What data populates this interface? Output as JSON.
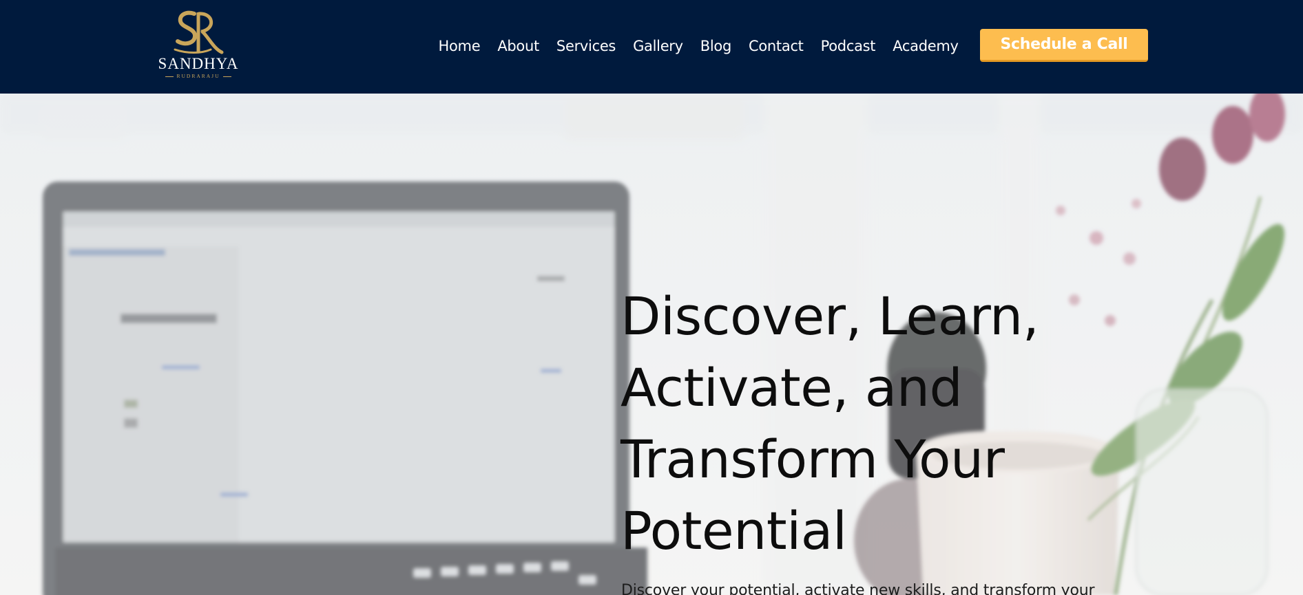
{
  "brand": {
    "logo_letters": "SR",
    "name": "SANDHYA",
    "subname": "RUDRARAJU",
    "gold_color": "#c9a55a"
  },
  "nav": {
    "items": [
      {
        "label": "Home"
      },
      {
        "label": "About"
      },
      {
        "label": "Services"
      },
      {
        "label": "Gallery"
      },
      {
        "label": "Blog"
      },
      {
        "label": "Contact"
      },
      {
        "label": "Podcast"
      },
      {
        "label": "Academy"
      }
    ],
    "cta_label": "Schedule a Call"
  },
  "hero": {
    "title_lines": [
      "Discover, Learn,",
      "Activate, and",
      "Transform Your",
      "Potential"
    ],
    "subtitle": "Discover your potential, activate new skills, and transform your"
  },
  "colors": {
    "header_bg": "#001a3d",
    "cta_bg": "#fdbd4f",
    "cta_text": "#ffffff",
    "nav_text": "#ffffff"
  }
}
